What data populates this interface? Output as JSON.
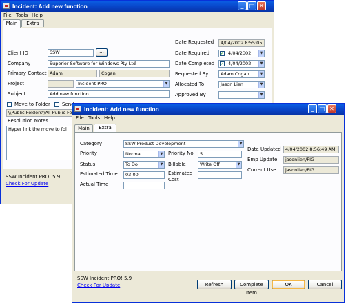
{
  "back_window": {
    "title": "Incident: Add new function",
    "menu": [
      "File",
      "Tools",
      "Help"
    ],
    "tabs": [
      "Main",
      "Extra"
    ],
    "labels": {
      "client_id": "Client ID",
      "company": "Company",
      "primary_contact": "Primary Contact",
      "project": "Project",
      "subject": "Subject",
      "date_requested": "Date Requested",
      "date_required": "Date Required",
      "date_completed": "Date Completed",
      "requested_by": "Requested By",
      "allocated_to": "Allocated To",
      "approved_by": "Approved By",
      "move_to_folder": "Move to Folder",
      "send": "Send",
      "resolution_notes": "Resolution Notes"
    },
    "values": {
      "client_id": "SSW",
      "browse": "...",
      "company": "Superior Software for Windows Pty Ltd",
      "contact_first": "Adam",
      "contact_last": "Cogan",
      "project": "Incident PRO",
      "subject": "Add new function",
      "date_requested": "4/04/2002 8:55:05 AM",
      "date_required": "4/04/2002",
      "date_completed": "4/04/2002",
      "requested_by": "Adam Cogan",
      "allocated_to": "Jason Lien",
      "approved_by": "",
      "folder_path": "\\\\Public Folders\\\\All Public Folder",
      "resolution_notes": "Hyper link the move to fol"
    },
    "status": "SSW Incident PRO! 5.9",
    "update_link": "Check For Update"
  },
  "front_window": {
    "title": "Incident: Add new function",
    "menu": [
      "File",
      "Tools",
      "Help"
    ],
    "tabs": [
      "Main",
      "Extra"
    ],
    "labels": {
      "category": "Category",
      "priority": "Priority",
      "status": "Status",
      "estimated_time": "Estimated Time",
      "actual_time": "Actual Time",
      "priority_no": "Priority No.",
      "billable": "Billable",
      "estimated_cost_1": "Estimated",
      "estimated_cost_2": "Cost",
      "date_updated": "Date Updated",
      "emp_update": "Emp Update",
      "current_use": "Current Use"
    },
    "values": {
      "category": "SSW Product Development",
      "priority": "Normal",
      "status": "To Do",
      "estimated_time": "03:00",
      "actual_time": "",
      "priority_no": "5",
      "billable": "Write Off",
      "estimated_cost": "",
      "date_updated": "4/04/2002 8:56:49 AM",
      "emp_update": "jasonlien/PIG",
      "current_use": "jasonlien/PIG"
    },
    "buttons": {
      "refresh": "Refresh",
      "complete_item": "Complete Item",
      "ok": "OK",
      "cancel": "Cancel"
    },
    "status": "SSW Incident PRO! 5.9",
    "update_link": "Check For Update"
  },
  "colors": {
    "titlebar": "#0842c4",
    "window_face": "#ece9d8",
    "close_button": "#c0392b",
    "link": "#0000ee"
  }
}
